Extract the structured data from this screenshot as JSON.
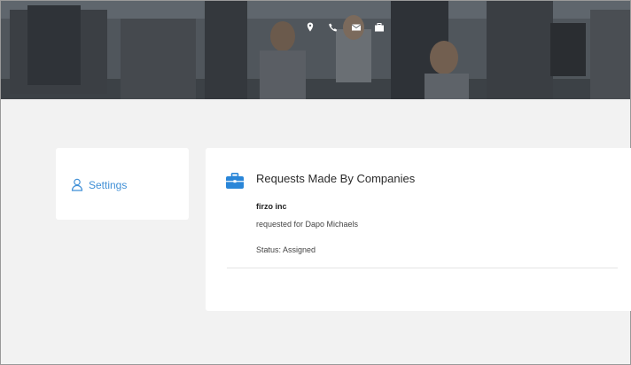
{
  "header": {
    "contact_icons": [
      "map-pin-icon",
      "phone-icon",
      "envelope-icon",
      "briefcase-icon"
    ]
  },
  "sidebar": {
    "items": [
      {
        "label": "Settings",
        "icon": "user-icon"
      }
    ]
  },
  "requests": {
    "title": "Requests Made By Companies",
    "icon": "briefcase-icon",
    "items": [
      {
        "company": "firzo inc",
        "request_text": "requested for Dapo Michaels",
        "status_text": "Status: Assigned"
      }
    ]
  },
  "colors": {
    "accent": "#3f8fd6",
    "page_background": "#f2f2f2",
    "card_background": "#ffffff",
    "header_overlay": "#4a4f54"
  }
}
